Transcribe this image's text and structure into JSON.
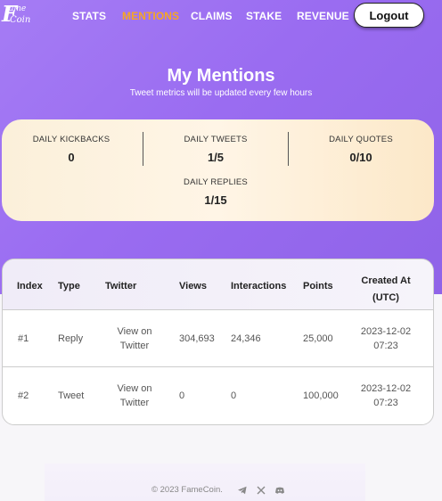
{
  "nav": {
    "logo_line1": "F",
    "logo_line2": "ame",
    "logo_line3": "Coin",
    "items": [
      {
        "label": "STATS",
        "active": false
      },
      {
        "label": "MENTIONS",
        "active": true
      },
      {
        "label": "CLAIMS",
        "active": false
      },
      {
        "label": "STAKE",
        "active": false
      },
      {
        "label": "REVENUE",
        "active": false
      }
    ],
    "logout_label": "Logout",
    "active_color": "#f6a623"
  },
  "header": {
    "title": "My Mentions",
    "subtitle": "Tweet metrics will be updated every few hours"
  },
  "stats": {
    "kickbacks": {
      "label": "DAILY KICKBACKS",
      "value": "0"
    },
    "tweets": {
      "label": "DAILY TWEETS",
      "value": "1/5"
    },
    "quotes": {
      "label": "DAILY QUOTES",
      "value": "0/10"
    },
    "replies": {
      "label": "DAILY REPLIES",
      "value": "1/15"
    }
  },
  "table": {
    "headers": {
      "index": "Index",
      "type": "Type",
      "twitter": "Twitter",
      "views": "Views",
      "interactions": "Interactions",
      "points": "Points",
      "created_line1": "Created At",
      "created_line2": "(UTC)"
    },
    "rows": [
      {
        "index": "#1",
        "type": "Reply",
        "twitter_line1": "View on",
        "twitter_line2": "Twitter",
        "views": "304,693",
        "interactions": "24,346",
        "points": "25,000",
        "date": "2023-12-02",
        "time": "07:23"
      },
      {
        "index": "#2",
        "type": "Tweet",
        "twitter_line1": "View on",
        "twitter_line2": "Twitter",
        "views": "0",
        "interactions": "0",
        "points": "100,000",
        "date": "2023-12-02",
        "time": "07:23"
      }
    ]
  },
  "footer": {
    "copyright": "© 2023 FameCoin.",
    "icons": [
      "telegram-icon",
      "x-icon",
      "discord-icon"
    ]
  }
}
